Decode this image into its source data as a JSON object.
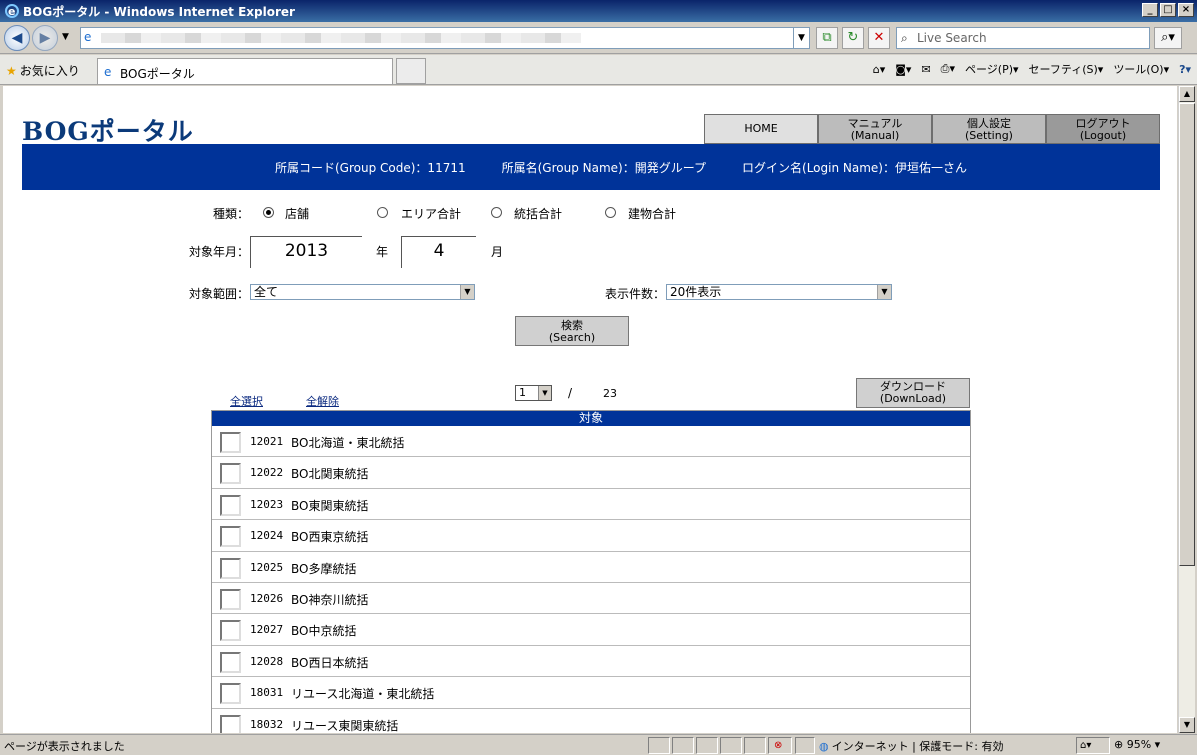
{
  "window": {
    "title": "BOGポータル - Windows Internet Explorer"
  },
  "browser": {
    "search_placeholder": "Live Search",
    "favorites_label": "お気に入り",
    "tab_title": "BOGポータル",
    "cmd_page": "ページ(P)",
    "cmd_safety": "セーフティ(S)",
    "cmd_tools": "ツール(O)",
    "status_text": "ページが表示されました",
    "zone_text": "インターネット | 保護モード: 有効",
    "zoom": "95%"
  },
  "page": {
    "logo": "BOGポータル",
    "nav": [
      {
        "line1": "HOME",
        "line2": ""
      },
      {
        "line1": "マニュアル",
        "line2": "(Manual)"
      },
      {
        "line1": "個人設定",
        "line2": "(Setting)"
      },
      {
        "line1": "ログアウト",
        "line2": "(Logout)"
      }
    ],
    "banner": {
      "group_code": "所属コード(Group Code)：11711",
      "group_name": "所属名(Group Name)：開発グループ",
      "login_name": "ログイン名(Login Name)：伊垣佑一さん"
    },
    "form": {
      "type_label": "種類：",
      "types": [
        "店舗",
        "エリア合計",
        "統括合計",
        "建物合計"
      ],
      "selected_type": "店舗",
      "period_label": "対象年月：",
      "year": "2013",
      "year_unit": "年",
      "month": "4",
      "month_unit": "月",
      "scope_label": "対象範囲：",
      "scope_value": "全て",
      "count_label": "表示件数：",
      "count_value": "20件表示",
      "search_line1": "検索",
      "search_line2": "(Search)"
    },
    "list": {
      "select_all": "全選択",
      "deselect_all": "全解除",
      "page_current": "1",
      "page_sep": "/",
      "page_total": "23",
      "download_line1": "ダウンロード",
      "download_line2": "(DownLoad)",
      "header": "対象",
      "rows": [
        {
          "code": "12021",
          "name": "BO北海道・東北統括"
        },
        {
          "code": "12022",
          "name": "BO北関東統括"
        },
        {
          "code": "12023",
          "name": "BO東関東統括"
        },
        {
          "code": "12024",
          "name": "BO西東京統括"
        },
        {
          "code": "12025",
          "name": "BO多摩統括"
        },
        {
          "code": "12026",
          "name": "BO神奈川統括"
        },
        {
          "code": "12027",
          "name": "BO中京統括"
        },
        {
          "code": "12028",
          "name": "BO西日本統括"
        },
        {
          "code": "18031",
          "name": "リユース北海道・東北統括"
        },
        {
          "code": "18032",
          "name": "リユース東関東統括"
        }
      ]
    }
  }
}
